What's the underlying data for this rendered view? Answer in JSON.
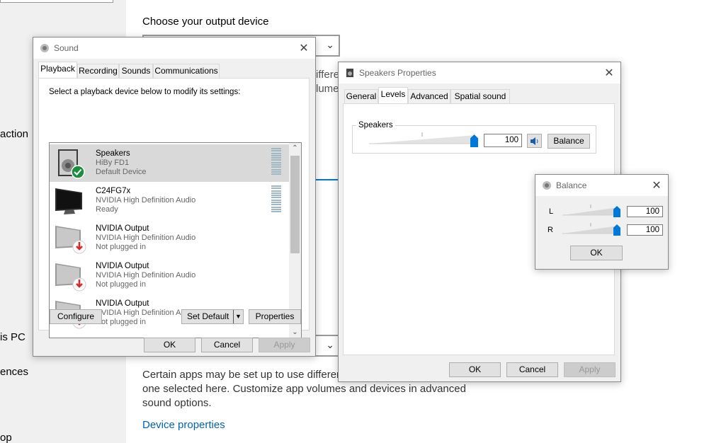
{
  "background": {
    "heading": "Choose your output device",
    "nav_partial": [
      " action",
      "is PC",
      "ences",
      "op"
    ],
    "partial_texts": [
      "ifferen",
      "lume"
    ],
    "description": "Certain apps may be set up to use different output devices than the one selected here. Customize app volumes and devices in advanced sound options.",
    "description_lines": [
      "Certain apps may be set up to use differen",
      "one selected here. Customize app volumes and devices in advanced",
      "sound options."
    ],
    "link": "Device properties"
  },
  "sound_dialog": {
    "title": "Sound",
    "tabs": [
      "Playback",
      "Recording",
      "Sounds",
      "Communications"
    ],
    "active_tab": "Playback",
    "instruction": "Select a playback device below to modify its settings:",
    "devices": [
      {
        "name": "Speakers",
        "line1": "HiBy FD1",
        "line2": "Default Device",
        "icon": "speaker-icon",
        "status": "default-check"
      },
      {
        "name": "C24FG7x",
        "line1": "NVIDIA High Definition Audio",
        "line2": "Ready",
        "icon": "monitor-icon",
        "status": "ready"
      },
      {
        "name": "NVIDIA Output",
        "line1": "NVIDIA High Definition Audio",
        "line2": "Not plugged in",
        "icon": "monitor-icon",
        "status": "unplugged"
      },
      {
        "name": "NVIDIA Output",
        "line1": "NVIDIA High Definition Audio",
        "line2": "Not plugged in",
        "icon": "monitor-icon",
        "status": "unplugged"
      },
      {
        "name": "NVIDIA Output",
        "line1": "NVIDIA High Definition Audio",
        "line2": "Not plugged in",
        "icon": "monitor-icon",
        "status": "unplugged"
      }
    ],
    "buttons": {
      "configure": "Configure",
      "set_default": "Set Default",
      "properties": "Properties",
      "ok": "OK",
      "cancel": "Cancel",
      "apply": "Apply"
    }
  },
  "speakers_dialog": {
    "title": "Speakers Properties",
    "tabs": [
      "General",
      "Levels",
      "Advanced",
      "Spatial sound"
    ],
    "active_tab": "Levels",
    "group_label": "Speakers",
    "level_value": "100",
    "level_fraction": 1.0,
    "buttons": {
      "balance": "Balance",
      "ok": "OK",
      "cancel": "Cancel",
      "apply": "Apply"
    }
  },
  "balance_dialog": {
    "title": "Balance",
    "channels": [
      {
        "label": "L",
        "value": "100",
        "fraction": 1.0
      },
      {
        "label": "R",
        "value": "100",
        "fraction": 1.0
      }
    ],
    "ok": "OK"
  },
  "colors": {
    "accent": "#0078d7",
    "link": "#0063b1",
    "check_green": "#1e8e3e",
    "unplug_red": "#d42a2a"
  }
}
